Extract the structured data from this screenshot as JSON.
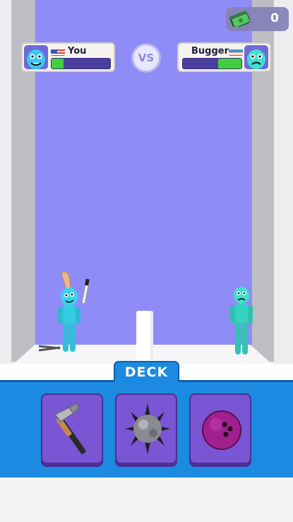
{
  "currency": {
    "amount": "0",
    "icon": "cash-icon"
  },
  "player": {
    "name": "You",
    "health": 0.2,
    "flag": "us-flag",
    "avatar": "blue-monster-avatar"
  },
  "opponent": {
    "name": "Bugger",
    "health": 0.4,
    "flag": "uzbekistan-flag",
    "avatar": "cyan-monster-avatar"
  },
  "vs_label": "VS",
  "deck": {
    "title": "DECK",
    "cards": [
      {
        "item": "hammer-icon"
      },
      {
        "item": "spiked-ball-icon"
      },
      {
        "item": "bowling-ball-icon"
      }
    ]
  },
  "colors": {
    "arena_back": "#8f8cf7",
    "tray": "#1c8ae0",
    "card": "#7a55d4",
    "health": "#3fcf3c"
  }
}
